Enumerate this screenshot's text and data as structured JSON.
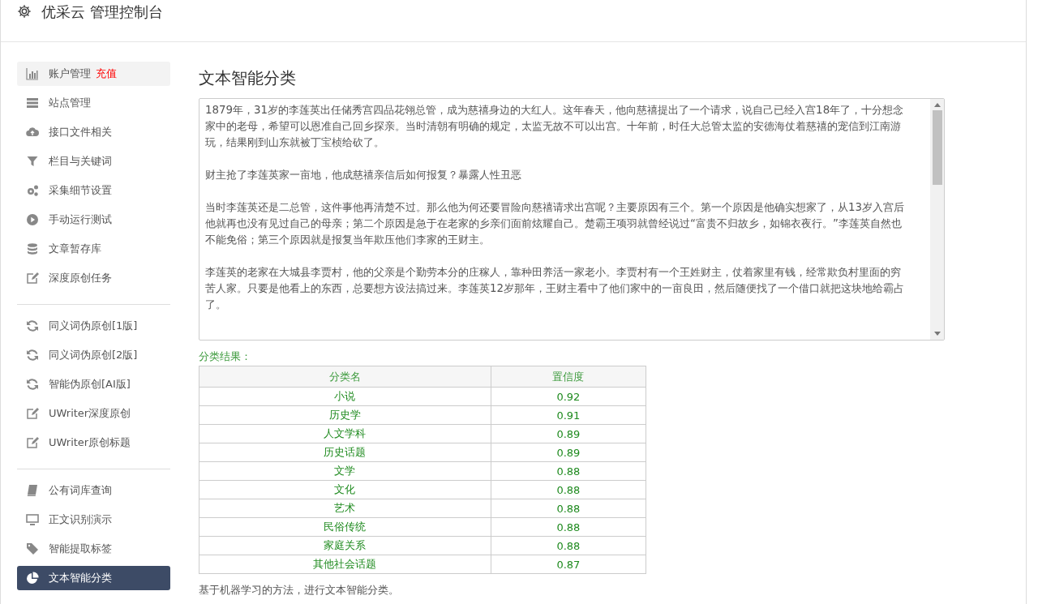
{
  "header": {
    "title": "优采云 管理控制台"
  },
  "sidebar": {
    "groups": [
      {
        "items": [
          {
            "label": "账户管理",
            "badge": "充值",
            "selected": false,
            "highlighted": true
          },
          {
            "label": "站点管理",
            "selected": false,
            "highlighted": false
          },
          {
            "label": "接口文件相关",
            "selected": false,
            "highlighted": false
          },
          {
            "label": "栏目与关键词",
            "selected": false,
            "highlighted": false
          },
          {
            "label": "采集细节设置",
            "selected": false,
            "highlighted": false
          },
          {
            "label": "手动运行测试",
            "selected": false,
            "highlighted": false
          },
          {
            "label": "文章暂存库",
            "selected": false,
            "highlighted": false
          },
          {
            "label": "深度原创任务",
            "selected": false,
            "highlighted": false
          }
        ]
      },
      {
        "items": [
          {
            "label": "同义词伪原创[1版]",
            "selected": false,
            "highlighted": false
          },
          {
            "label": "同义词伪原创[2版]",
            "selected": false,
            "highlighted": false
          },
          {
            "label": "智能伪原创[AI版]",
            "selected": false,
            "highlighted": false
          },
          {
            "label": "UWriter深度原创",
            "selected": false,
            "highlighted": false
          },
          {
            "label": "UWriter原创标题",
            "selected": false,
            "highlighted": false
          }
        ]
      },
      {
        "items": [
          {
            "label": "公有词库查询",
            "selected": false,
            "highlighted": false
          },
          {
            "label": "正文识别演示",
            "selected": false,
            "highlighted": false
          },
          {
            "label": "智能提取标签",
            "selected": false,
            "highlighted": false
          },
          {
            "label": "文本智能分类",
            "selected": true,
            "highlighted": false
          }
        ]
      }
    ]
  },
  "main": {
    "title": "文本智能分类",
    "article": [
      "1879年，31岁的李莲英出任储秀宫四品花翎总管，成为慈禧身边的大红人。这年春天，他向慈禧提出了一个请求，说自己已经入宫18年了，十分想念家中的老母，希望可以恩准自己回乡探亲。当时清朝有明确的规定，太监无故不可以出宫。十年前，时任大总管太监的安德海仗着慈禧的宠信到江南游玩，结果刚到山东就被丁宝桢给砍了。",
      "财主抢了李莲英家一亩地，他成慈禧亲信后如何报复？暴露人性丑恶",
      "当时李莲英还是二总管，这件事他再清楚不过。那么他为何还要冒险向慈禧请求出宫呢？主要原因有三个。第一个原因是他确实想家了，从13岁入宫后他就再也没有见过自己的母亲；第二个原因是急于在老家的乡亲们面前炫耀自己。楚霸王项羽就曾经说过“富贵不归故乡，如锦衣夜行。”李莲英自然也不能免俗；第三个原因就是报复当年欺压他们李家的王财主。",
      "李莲英的老家在大城县李贾村，他的父亲是个勤劳本分的庄稼人，靠种田养活一家老小。李贾村有一个王姓财主，仗着家里有钱，经常欺负村里面的穷苦人家。只要是他看上的东西，总要想方设法搞过来。李莲英12岁那年，王财主看中了他们家中的一亩良田，然后随便找了一个借口就把这块地给霸占了。"
    ],
    "result_label": "分类结果：",
    "table": {
      "columns": [
        "分类名",
        "置信度"
      ],
      "rows": [
        [
          "小说",
          "0.92"
        ],
        [
          "历史学",
          "0.91"
        ],
        [
          "人文学科",
          "0.89"
        ],
        [
          "历史话题",
          "0.89"
        ],
        [
          "文学",
          "0.88"
        ],
        [
          "文化",
          "0.88"
        ],
        [
          "艺术",
          "0.88"
        ],
        [
          "民俗传统",
          "0.88"
        ],
        [
          "家庭关系",
          "0.88"
        ],
        [
          "其他社会话题",
          "0.87"
        ]
      ]
    },
    "footnote": "基于机器学习的方法，进行文本智能分类。"
  }
}
